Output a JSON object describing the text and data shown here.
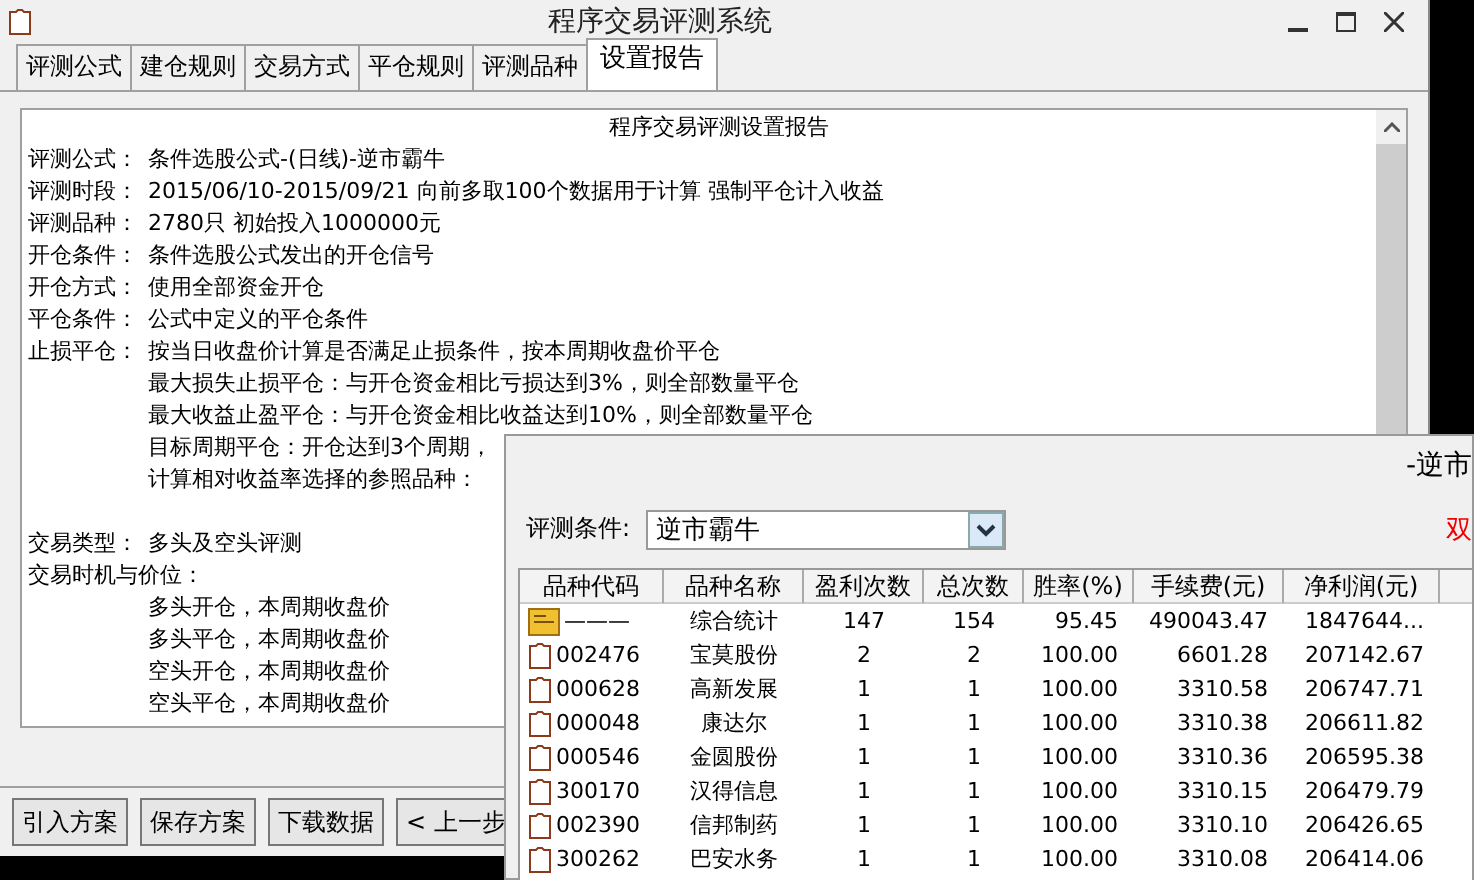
{
  "window": {
    "title": "程序交易评测系统"
  },
  "tabs": [
    {
      "label": "评测公式",
      "selected": false
    },
    {
      "label": "建仓规则",
      "selected": false
    },
    {
      "label": "交易方式",
      "selected": false
    },
    {
      "label": "平仓规则",
      "selected": false
    },
    {
      "label": "评测品种",
      "selected": false
    },
    {
      "label": "设置报告",
      "selected": true
    }
  ],
  "report": {
    "title": "程序交易评测设置报告",
    "sections": [
      [
        {
          "label": "评测公式：",
          "value": "条件选股公式-(日线)-逆市霸牛"
        },
        {
          "label": "评测时段：",
          "value": "2015/06/10-2015/09/21 向前多取100个数据用于计算 强制平仓计入收益"
        },
        {
          "label": "评测品种：",
          "value": "2780只 初始投入1000000元"
        },
        {
          "label": "开仓条件：",
          "value": "条件选股公式发出的开仓信号"
        },
        {
          "label": "开仓方式：",
          "value": "使用全部资金开仓"
        },
        {
          "label": "平仓条件：",
          "value": "公式中定义的平仓条件"
        },
        {
          "label": "止损平仓：",
          "value": "按当日收盘价计算是否满足止损条件，按本周期收盘价平仓"
        },
        {
          "value": "最大损失止损平仓：与开仓资金相比亏损达到3%，则全部数量平仓"
        },
        {
          "value": "最大收益止盈平仓：与开仓资金相比收益达到10%，则全部数量平仓"
        },
        {
          "value": "目标周期平仓：开仓达到3个周期，"
        },
        {
          "value": "计算相对收益率选择的参照品种："
        }
      ],
      [
        {
          "label": "交易类型：",
          "value": "多头及空头评测"
        },
        {
          "label": "交易时机与价位："
        },
        {
          "value": "多头开仓，本周期收盘价"
        },
        {
          "value": "多头平仓，本周期收盘价"
        },
        {
          "value": "空头开仓，本周期收盘价"
        },
        {
          "value": "空头平仓，本周期收盘价"
        }
      ]
    ]
  },
  "buttons": [
    "引入方案",
    "保存方案",
    "下载数据",
    "< 上一步"
  ],
  "result_window": {
    "title": "-逆市",
    "condition_label": "评测条件:",
    "condition_value": "逆市霸牛",
    "hint": "双",
    "columns": [
      "品种代码",
      "品种名称",
      "盈利次数",
      "总次数",
      "胜率(%)",
      "手续费(元)",
      "净利润(元)"
    ],
    "rows": [
      {
        "kind": "summary",
        "cells": [
          "———",
          "综合统计",
          "147",
          "154",
          "95.45",
          "490043.47",
          "1847644..."
        ]
      },
      {
        "kind": "stock",
        "cells": [
          "002476",
          "宝莫股份",
          "2",
          "2",
          "100.00",
          "6601.28",
          "207142.67"
        ]
      },
      {
        "kind": "stock",
        "cells": [
          "000628",
          "高新发展",
          "1",
          "1",
          "100.00",
          "3310.58",
          "206747.71"
        ]
      },
      {
        "kind": "stock",
        "cells": [
          "000048",
          "康达尔",
          "1",
          "1",
          "100.00",
          "3310.38",
          "206611.82"
        ]
      },
      {
        "kind": "stock",
        "cells": [
          "000546",
          "金圆股份",
          "1",
          "1",
          "100.00",
          "3310.36",
          "206595.38"
        ]
      },
      {
        "kind": "stock",
        "cells": [
          "300170",
          "汉得信息",
          "1",
          "1",
          "100.00",
          "3310.15",
          "206479.79"
        ]
      },
      {
        "kind": "stock",
        "cells": [
          "002390",
          "信邦制药",
          "1",
          "1",
          "100.00",
          "3310.10",
          "206426.65"
        ]
      },
      {
        "kind": "stock",
        "cells": [
          "300262",
          "巴安水务",
          "1",
          "1",
          "100.00",
          "3310.08",
          "206414.06"
        ]
      }
    ]
  }
}
